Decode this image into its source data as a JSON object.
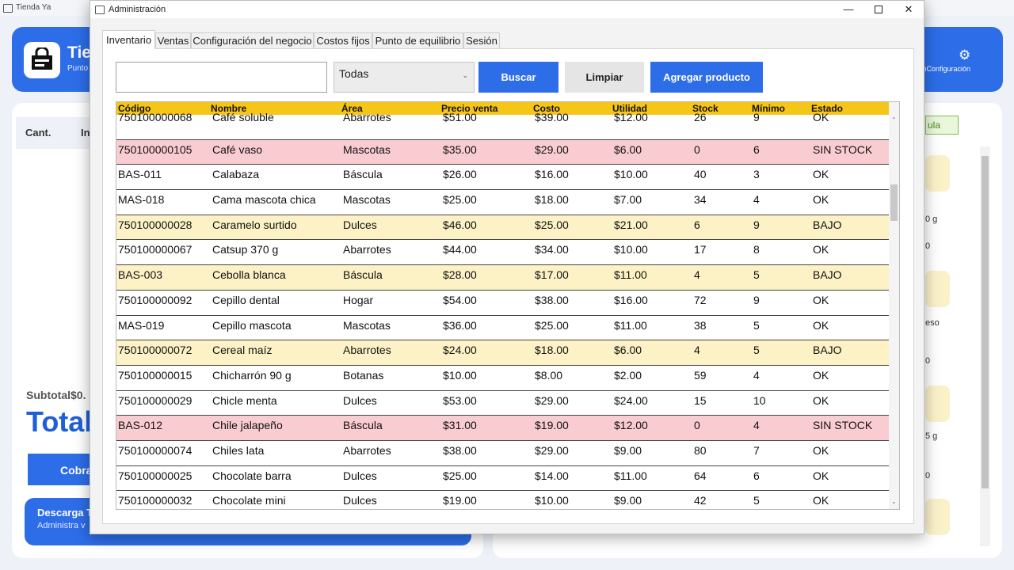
{
  "background_app": {
    "title": "Tienda Ya",
    "brand": "Tie",
    "brand_sub": "Punto",
    "config_label": "aciónConfiguración",
    "cart_headers": {
      "cant": "Cant.",
      "in": "In"
    },
    "subtotal": "Subtotal$0.",
    "total": "Total",
    "cobrar": "Cobra",
    "descarga_title": "Descarga T",
    "descarga_sub": "Administra v",
    "badge": "ula",
    "side_texts": [
      "0 g",
      "0",
      "eso",
      "0",
      "5 g",
      "0"
    ]
  },
  "window": {
    "title": "Administración",
    "controls": {
      "minimize": "—",
      "close": "✕"
    }
  },
  "tabs": [
    {
      "label": "Inventario",
      "active": true
    },
    {
      "label": "Ventas",
      "active": false
    },
    {
      "label": "Configuración del negocio",
      "active": false
    },
    {
      "label": "Costos fijos",
      "active": false
    },
    {
      "label": "Punto de equilibrio",
      "active": false
    },
    {
      "label": "Sesión",
      "active": false
    }
  ],
  "toolbar": {
    "search_value": "",
    "area_selected": "Todas",
    "buscar": "Buscar",
    "limpiar": "Limpiar",
    "agregar": "Agregar producto"
  },
  "colors": {
    "accent": "#2d6de8",
    "header": "#f5c518",
    "bajo_row": "#fcf2c6",
    "sin_stock_row": "#f9ccd2"
  },
  "grid": {
    "headers": [
      "Código",
      "Nombre",
      "Área",
      "Precio venta",
      "Costo",
      "Utilidad",
      "Stock",
      "Mínimo",
      "Estado"
    ],
    "rows": [
      [
        "750100000068",
        "Café soluble",
        "Abarrotes",
        "$51.00",
        "$39.00",
        "$12.00",
        "26",
        "9",
        "OK"
      ],
      [
        "750100000105",
        "Café vaso",
        "Mascotas",
        "$35.00",
        "$29.00",
        "$6.00",
        "0",
        "6",
        "SIN STOCK"
      ],
      [
        "BAS-011",
        "Calabaza",
        "Báscula",
        "$26.00",
        "$16.00",
        "$10.00",
        "40",
        "3",
        "OK"
      ],
      [
        "MAS-018",
        "Cama mascota chica",
        "Mascotas",
        "$25.00",
        "$18.00",
        "$7.00",
        "34",
        "4",
        "OK"
      ],
      [
        "750100000028",
        "Caramelo surtido",
        "Dulces",
        "$46.00",
        "$25.00",
        "$21.00",
        "6",
        "9",
        "BAJO"
      ],
      [
        "750100000067",
        "Catsup 370 g",
        "Abarrotes",
        "$44.00",
        "$34.00",
        "$10.00",
        "17",
        "8",
        "OK"
      ],
      [
        "BAS-003",
        "Cebolla blanca",
        "Báscula",
        "$28.00",
        "$17.00",
        "$11.00",
        "4",
        "5",
        "BAJO"
      ],
      [
        "750100000092",
        "Cepillo dental",
        "Hogar",
        "$54.00",
        "$38.00",
        "$16.00",
        "72",
        "9",
        "OK"
      ],
      [
        "MAS-019",
        "Cepillo mascota",
        "Mascotas",
        "$36.00",
        "$25.00",
        "$11.00",
        "38",
        "5",
        "OK"
      ],
      [
        "750100000072",
        "Cereal maíz",
        "Abarrotes",
        "$24.00",
        "$18.00",
        "$6.00",
        "4",
        "5",
        "BAJO"
      ],
      [
        "750100000015",
        "Chicharrón 90 g",
        "Botanas",
        "$10.00",
        "$8.00",
        "$2.00",
        "59",
        "4",
        "OK"
      ],
      [
        "750100000029",
        "Chicle menta",
        "Dulces",
        "$53.00",
        "$29.00",
        "$24.00",
        "15",
        "10",
        "OK"
      ],
      [
        "BAS-012",
        "Chile jalapeño",
        "Báscula",
        "$31.00",
        "$19.00",
        "$12.00",
        "0",
        "4",
        "SIN STOCK"
      ],
      [
        "750100000074",
        "Chiles lata",
        "Abarrotes",
        "$38.00",
        "$29.00",
        "$9.00",
        "80",
        "7",
        "OK"
      ],
      [
        "750100000025",
        "Chocolate barra",
        "Dulces",
        "$25.00",
        "$14.00",
        "$11.00",
        "64",
        "6",
        "OK"
      ],
      [
        "750100000032",
        "Chocolate mini",
        "Dulces",
        "$19.00",
        "$10.00",
        "$9.00",
        "42",
        "5",
        "OK"
      ]
    ]
  }
}
